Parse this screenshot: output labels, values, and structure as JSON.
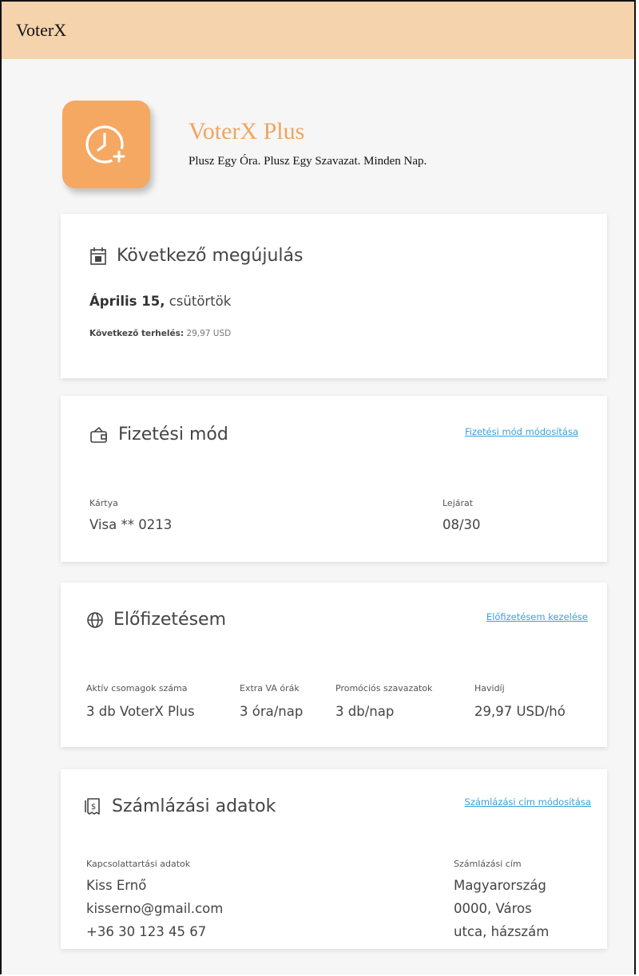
{
  "appbar": {
    "title": "VoterX"
  },
  "hero": {
    "logo_icon": "clock-plus-icon",
    "title": "VoterX Plus",
    "subtitle": "Plusz Egy Óra. Plusz Egy Szavazat. Minden Nap."
  },
  "renewal": {
    "icon": "calendar-icon",
    "title": "Következő megújulás",
    "date_bold": "Április 15,",
    "date_rest": " csütörtök",
    "charge_label": "Következő terhelés:",
    "charge_value": " 29,97 USD"
  },
  "payment": {
    "icon": "wallet-icon",
    "title": "Fizetési mód",
    "link": "Fizetési mód módosítása",
    "card_label": "Kártya",
    "card_value": "Visa ** 0213",
    "expiry_label": "Lejárat",
    "expiry_value": "08/30"
  },
  "subscription": {
    "icon": "globe-icon",
    "title": "Előfizetésem",
    "link": "Előfizetésem kezelése",
    "fields": [
      {
        "label": "Aktív csomagok száma",
        "value": "3 db VoterX Plus"
      },
      {
        "label": "Extra VA órák",
        "value": "3 óra/nap"
      },
      {
        "label": "Promóciós szavazatok",
        "value": "3 db/nap"
      },
      {
        "label": "Havidíj",
        "value": "29,97 USD/hó"
      }
    ]
  },
  "billing": {
    "icon": "receipt-icon",
    "title": "Számlázási adatok",
    "link": "Számlázási cím módosítása",
    "contact_label": "Kapcsolattartási adatok",
    "contact_lines": [
      "Kiss Ernő",
      "kisserno@gmail.com",
      "+36 30 123 45 67"
    ],
    "address_label": "Számlázási cím",
    "address_lines": [
      "Magyarország",
      "0000, Város",
      "utca, házszám"
    ]
  },
  "colors": {
    "appbar_bg": "#f4d3ad",
    "accent": "#f0a55f",
    "logo_bg": "#f5a862",
    "link": "#3aa0d8"
  }
}
